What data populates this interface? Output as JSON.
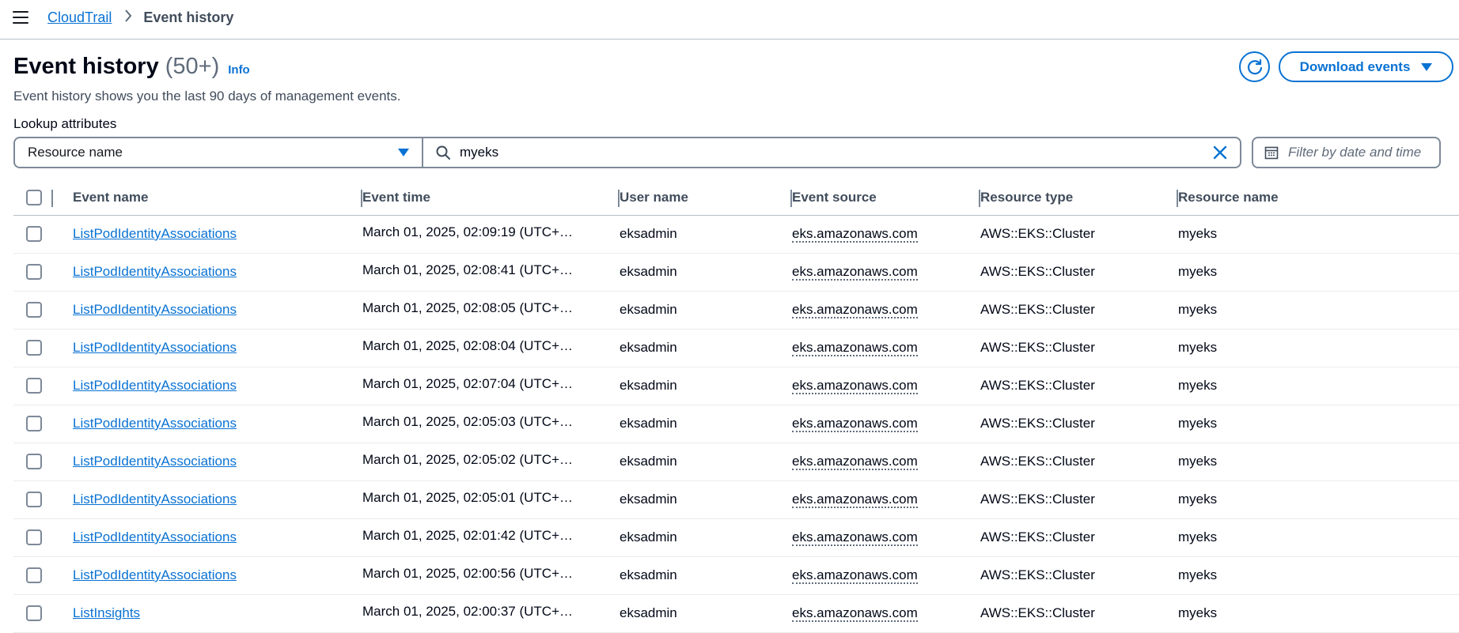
{
  "breadcrumb": {
    "root": "CloudTrail",
    "current": "Event history"
  },
  "header": {
    "title": "Event history",
    "count": "(50+)",
    "info": "Info",
    "description": "Event history shows you the last 90 days of management events.",
    "download_label": "Download events"
  },
  "lookup": {
    "label": "Lookup attributes",
    "attribute": "Resource name",
    "search_value": "myeks",
    "date_placeholder": "Filter by date and time"
  },
  "colors": {
    "link": "#0972d3",
    "border": "#7d8998",
    "text": "#000716"
  },
  "table": {
    "columns": [
      "Event name",
      "Event time",
      "User name",
      "Event source",
      "Resource type",
      "Resource name"
    ],
    "rows": [
      {
        "name": "ListPodIdentityAssociations",
        "time": "March 01, 2025, 02:09:19 (UTC+…",
        "user": "eksadmin",
        "source": "eks.amazonaws.com",
        "rtype": "AWS::EKS::Cluster",
        "rname": "myeks"
      },
      {
        "name": "ListPodIdentityAssociations",
        "time": "March 01, 2025, 02:08:41 (UTC+…",
        "user": "eksadmin",
        "source": "eks.amazonaws.com",
        "rtype": "AWS::EKS::Cluster",
        "rname": "myeks"
      },
      {
        "name": "ListPodIdentityAssociations",
        "time": "March 01, 2025, 02:08:05 (UTC+…",
        "user": "eksadmin",
        "source": "eks.amazonaws.com",
        "rtype": "AWS::EKS::Cluster",
        "rname": "myeks"
      },
      {
        "name": "ListPodIdentityAssociations",
        "time": "March 01, 2025, 02:08:04 (UTC+…",
        "user": "eksadmin",
        "source": "eks.amazonaws.com",
        "rtype": "AWS::EKS::Cluster",
        "rname": "myeks"
      },
      {
        "name": "ListPodIdentityAssociations",
        "time": "March 01, 2025, 02:07:04 (UTC+…",
        "user": "eksadmin",
        "source": "eks.amazonaws.com",
        "rtype": "AWS::EKS::Cluster",
        "rname": "myeks"
      },
      {
        "name": "ListPodIdentityAssociations",
        "time": "March 01, 2025, 02:05:03 (UTC+…",
        "user": "eksadmin",
        "source": "eks.amazonaws.com",
        "rtype": "AWS::EKS::Cluster",
        "rname": "myeks"
      },
      {
        "name": "ListPodIdentityAssociations",
        "time": "March 01, 2025, 02:05:02 (UTC+…",
        "user": "eksadmin",
        "source": "eks.amazonaws.com",
        "rtype": "AWS::EKS::Cluster",
        "rname": "myeks"
      },
      {
        "name": "ListPodIdentityAssociations",
        "time": "March 01, 2025, 02:05:01 (UTC+…",
        "user": "eksadmin",
        "source": "eks.amazonaws.com",
        "rtype": "AWS::EKS::Cluster",
        "rname": "myeks"
      },
      {
        "name": "ListPodIdentityAssociations",
        "time": "March 01, 2025, 02:01:42 (UTC+…",
        "user": "eksadmin",
        "source": "eks.amazonaws.com",
        "rtype": "AWS::EKS::Cluster",
        "rname": "myeks"
      },
      {
        "name": "ListPodIdentityAssociations",
        "time": "March 01, 2025, 02:00:56 (UTC+…",
        "user": "eksadmin",
        "source": "eks.amazonaws.com",
        "rtype": "AWS::EKS::Cluster",
        "rname": "myeks"
      },
      {
        "name": "ListInsights",
        "time": "March 01, 2025, 02:00:37 (UTC+…",
        "user": "eksadmin",
        "source": "eks.amazonaws.com",
        "rtype": "AWS::EKS::Cluster",
        "rname": "myeks"
      }
    ]
  }
}
